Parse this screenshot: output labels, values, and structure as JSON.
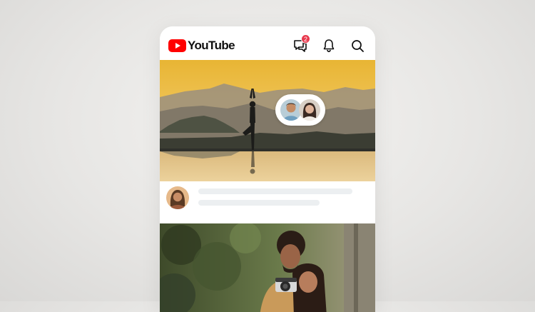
{
  "app": {
    "name": "YouTube"
  },
  "header": {
    "logo_text": "YouTube",
    "icons": [
      "chat-icon",
      "bell-icon",
      "search-icon"
    ],
    "chat_badge_count": "2"
  },
  "colors": {
    "brand_red": "#ff0000",
    "badge_red": "#e8394d",
    "skeleton": "#eceff1"
  },
  "feed": {
    "post_1": {
      "image": "silhouette-yoga-tree-pose-sunset-lake",
      "viewers": 2
    },
    "post_2": {
      "image": "couple-with-camera-outdoors"
    }
  }
}
